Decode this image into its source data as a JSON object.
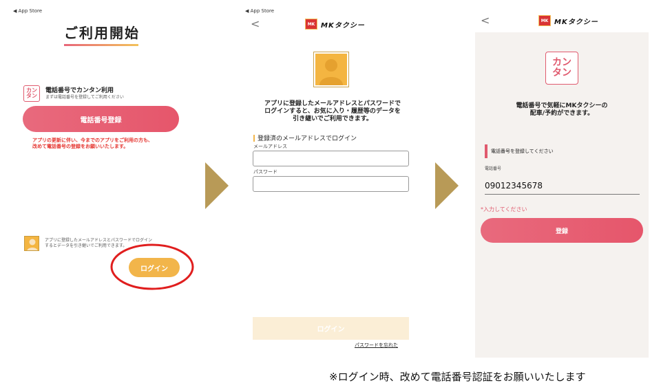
{
  "screen1": {
    "status": "◀ App Store",
    "title": "ご利用開始",
    "kantan_badge": [
      "カン",
      "タン"
    ],
    "phone_heading": "電話番号でカンタン利用",
    "phone_sub": "まずは電話番号を登録してご利用ください",
    "register_button": "電話番号登録",
    "notice_line1": "アプリの更新に伴い、今までのアプリをご利用の方も、",
    "notice_line2": "改めて電話番号の登録をお願いいたします。",
    "login_text_line1": "アプリに登録したメールアドレスとパスワードでログイン",
    "login_text_line2": "するとデータを引き継いでご利用できます。",
    "login_button": "ログイン"
  },
  "screen2": {
    "status": "◀ App Store",
    "back": "<",
    "logo_mark": "MK",
    "logo_text": "MKタクシー",
    "message_line1": "アプリに登録したメールアドレスとパスワードで",
    "message_line2": "ログインすると、お気に入り・履歴等のデータを",
    "message_line3": "引き継いでご利用できます。",
    "section_label": "登録済のメールアドレスでログイン",
    "email_label": "メールアドレス",
    "email_value": "",
    "password_label": "パスワード",
    "password_value": "",
    "login_button": "ログイン",
    "forgot_link": "パスワードを忘れた"
  },
  "screen3": {
    "back": "<",
    "logo_mark": "MK",
    "logo_text": "MKタクシー",
    "kantan_badge": [
      "カン",
      "タン"
    ],
    "message_line1": "電話番号で気軽にMKタクシーの",
    "message_line2": "配車/予約ができます。",
    "prompt": "電話番号を登録してください",
    "phone_label": "電話番号",
    "phone_value": "09012345678",
    "required_note": "*入力してください",
    "register_button": "登録"
  },
  "footer_note": "※ログイン時、改めて電話番号認証をお願いいたします",
  "colors": {
    "pink": "#e6566b",
    "yellow": "#f2b54a",
    "arrow": "#b89a57",
    "highlight_circle": "#e01e1e",
    "notice_red": "#e5322d"
  }
}
